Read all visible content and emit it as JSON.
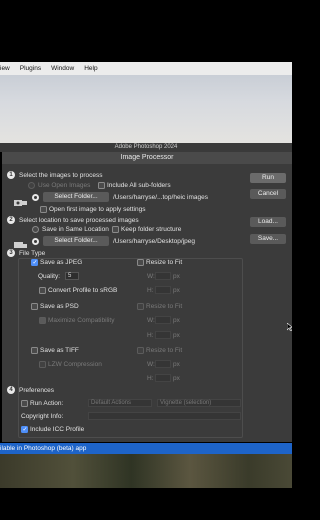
{
  "menubar": {
    "items": [
      "iew",
      "Plugins",
      "Window",
      "Help"
    ]
  },
  "app_title": "Adobe Photoshop 2024",
  "dialog": {
    "title": "Image Processor",
    "section1": {
      "number": "1",
      "heading": "Select the images to process",
      "use_open_images": "Use Open Images",
      "include_subfolders": "Include All sub-folders",
      "select_folder": "Select Folder...",
      "source_path": "/Users/harryse/...top/heic images",
      "open_first": "Open first image to apply settings"
    },
    "section2": {
      "number": "2",
      "heading": "Select location to save processed images",
      "same_location": "Save in Same Location",
      "keep_structure": "Keep folder structure",
      "select_folder": "Select Folder...",
      "dest_path": "/Users/harryse/Desktop/jpeg"
    },
    "section3": {
      "number": "3",
      "heading": "File Type",
      "save_jpeg": "Save as JPEG",
      "quality_label": "Quality:",
      "quality_value": "5",
      "convert_srgb": "Convert Profile to sRGB",
      "save_psd": "Save as PSD",
      "maximize": "Maximize Compatibility",
      "save_tiff": "Save as TIFF",
      "lzw": "LZW Compression",
      "resize": "Resize to Fit",
      "w_label": "W:",
      "h_label": "H:",
      "px": "px"
    },
    "section4": {
      "number": "4",
      "heading": "Preferences",
      "run_action": "Run Action:",
      "action_set": "Default Actions",
      "action_name": "Vignette (selection)",
      "copyright": "Copyright Info:",
      "include_icc": "Include ICC Profile"
    },
    "buttons": {
      "run": "Run",
      "cancel": "Cancel",
      "load": "Load...",
      "save": "Save..."
    }
  },
  "statusbar": "ilable in Photoshop (beta) app",
  "colors": {
    "accent": "#4e8ef7",
    "status_bar": "#1e64c8"
  }
}
